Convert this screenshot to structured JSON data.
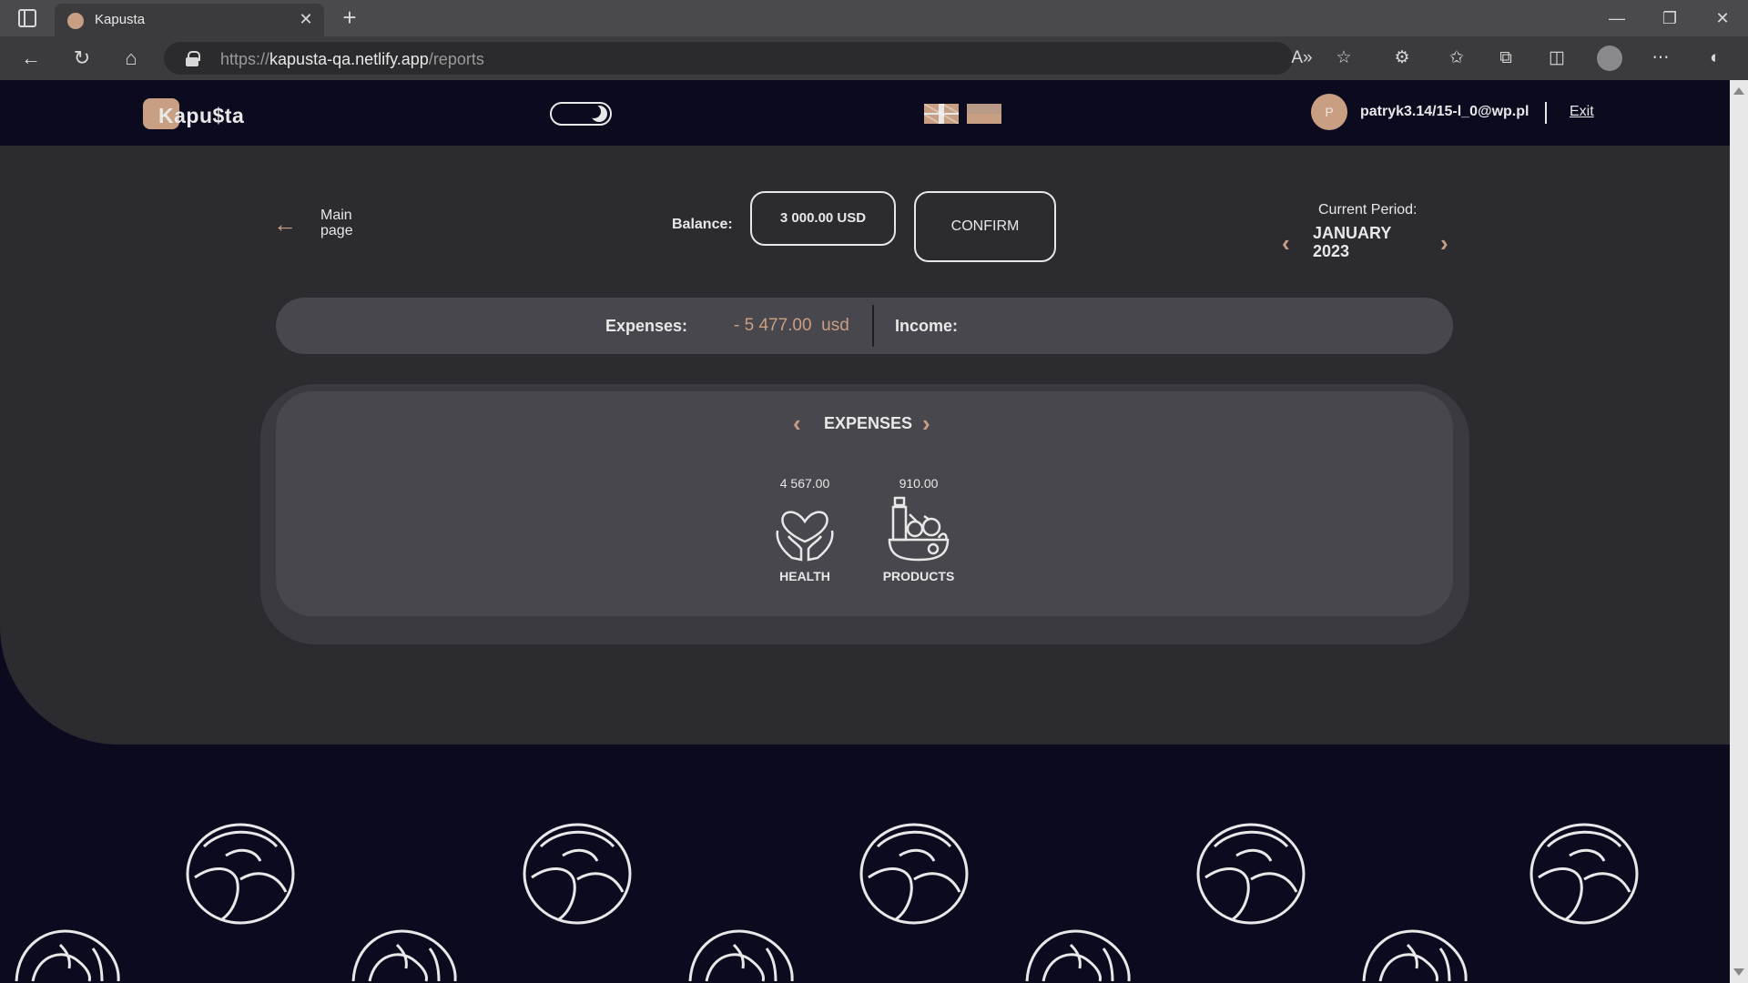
{
  "browser": {
    "tab_title": "Kapusta",
    "url_prefix": "https://",
    "url_host": "kapusta-qa.netlify.app",
    "url_path": "/reports"
  },
  "header": {
    "logo": "Kapu$ta",
    "avatar_letter": "P",
    "email": "patryk3.14/15-l_0@wp.pl",
    "exit_label": "Exit"
  },
  "toolbar": {
    "back_label": "Main page",
    "balance_label": "Balance:",
    "balance_value": "3 000.00 USD",
    "confirm_label": "CONFIRM",
    "period_label": "Current Period:",
    "period_month": "JANUARY",
    "period_year": "2023"
  },
  "summary": {
    "expenses_label": "Expenses:",
    "expenses_value": "- 5 477.00  usd",
    "income_label": "Income:"
  },
  "report": {
    "title": "EXPENSES",
    "categories": [
      {
        "amount": "4 567.00",
        "name": "HEALTH",
        "icon": "health-icon"
      },
      {
        "amount": "910.00",
        "name": "PRODUCTS",
        "icon": "products-icon"
      }
    ]
  },
  "colors": {
    "accent": "#c99f83",
    "header_bg": "#0b0a1f",
    "main_bg": "#2b2b30",
    "panel_bg": "#47474d"
  }
}
